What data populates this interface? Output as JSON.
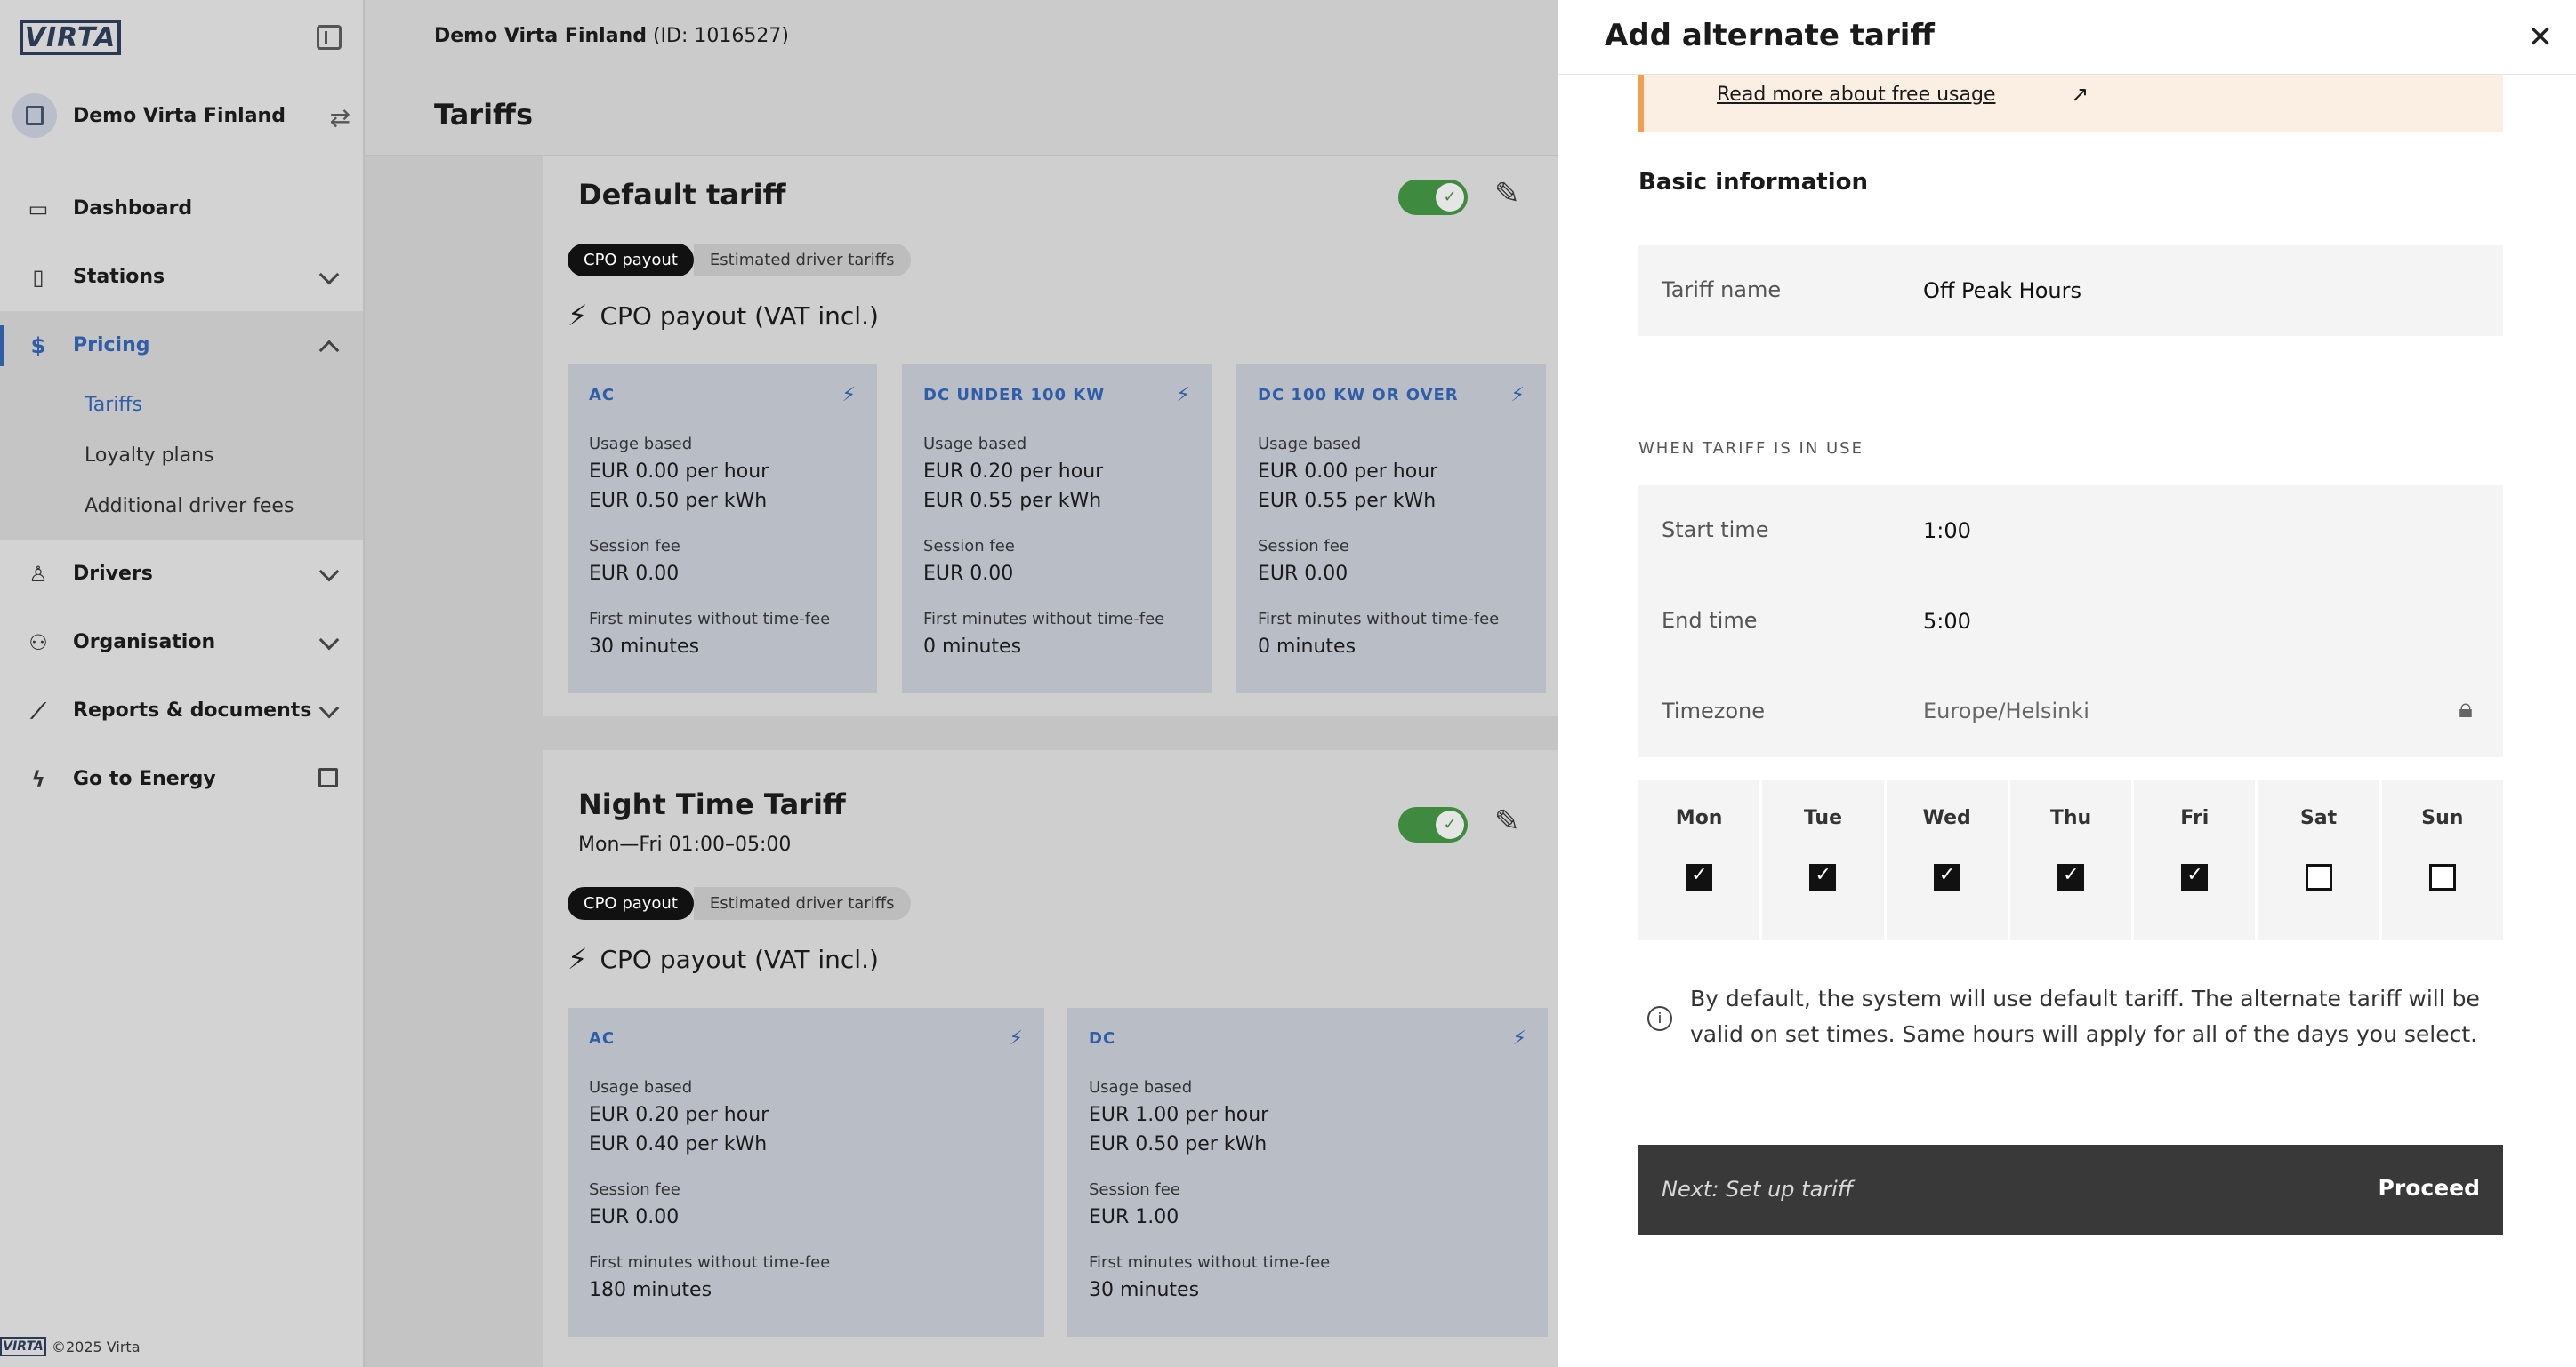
{
  "brand": {
    "logo_text": "VIRTA",
    "footer": "©2025 Virta"
  },
  "sidebar": {
    "org_name": "Demo Virta Finland",
    "items": [
      {
        "label": "Dashboard"
      },
      {
        "label": "Stations"
      },
      {
        "label": "Pricing"
      },
      {
        "label": "Drivers"
      },
      {
        "label": "Organisation"
      },
      {
        "label": "Reports & documents"
      },
      {
        "label": "Go to Energy"
      }
    ],
    "pricing_sub": [
      {
        "label": "Tariffs"
      },
      {
        "label": "Loyalty plans"
      },
      {
        "label": "Additional driver fees"
      }
    ]
  },
  "header": {
    "org_name": "Demo Virta Finland",
    "org_id": "(ID: 1016527)",
    "page_title": "Tariffs"
  },
  "tariffs": [
    {
      "name": "Default tariff",
      "schedule": "",
      "tabs": [
        "CPO payout",
        "Estimated driver tariffs"
      ],
      "payout_title": "CPO payout (VAT incl.)",
      "boxes": [
        {
          "type": "AC",
          "usage_label": "Usage based",
          "per_hour": "EUR 0.00 per hour",
          "per_kwh": "EUR 0.50 per kWh",
          "session_label": "Session fee",
          "session_fee": "EUR 0.00",
          "first_label": "First minutes without time-fee",
          "first_minutes": "30 minutes"
        },
        {
          "type": "DC UNDER 100 KW",
          "usage_label": "Usage based",
          "per_hour": "EUR 0.20 per hour",
          "per_kwh": "EUR 0.55 per kWh",
          "session_label": "Session fee",
          "session_fee": "EUR 0.00",
          "first_label": "First minutes without time-fee",
          "first_minutes": "0 minutes"
        },
        {
          "type": "DC 100 KW OR OVER",
          "usage_label": "Usage based",
          "per_hour": "EUR 0.00 per hour",
          "per_kwh": "EUR 0.55 per kWh",
          "session_label": "Session fee",
          "session_fee": "EUR 0.00",
          "first_label": "First minutes without time-fee",
          "first_minutes": "0 minutes"
        }
      ]
    },
    {
      "name": "Night Time Tariff",
      "schedule": "Mon—Fri 01:00–05:00",
      "tabs": [
        "CPO payout",
        "Estimated driver tariffs"
      ],
      "payout_title": "CPO payout (VAT incl.)",
      "boxes": [
        {
          "type": "AC",
          "usage_label": "Usage based",
          "per_hour": "EUR 0.20 per hour",
          "per_kwh": "EUR 0.40 per kWh",
          "session_label": "Session fee",
          "session_fee": "EUR 0.00",
          "first_label": "First minutes without time-fee",
          "first_minutes": "180 minutes"
        },
        {
          "type": "DC",
          "usage_label": "Usage based",
          "per_hour": "EUR 1.00 per hour",
          "per_kwh": "EUR 0.50 per kWh",
          "session_label": "Session fee",
          "session_fee": "EUR 1.00",
          "first_label": "First minutes without time-fee",
          "first_minutes": "30 minutes"
        }
      ]
    }
  ],
  "panel": {
    "title": "Add alternate tariff",
    "notice_link": "Read more about free usage",
    "section_title": "Basic information",
    "tariff_name_label": "Tariff name",
    "tariff_name_value": "Off Peak Hours",
    "when_caption": "WHEN TARIFF IS IN USE",
    "start_label": "Start time",
    "start_value": "1:00",
    "end_label": "End time",
    "end_value": "5:00",
    "timezone_label": "Timezone",
    "timezone_value": "Europe/Helsinki",
    "days": [
      {
        "label": "Mon",
        "checked": true
      },
      {
        "label": "Tue",
        "checked": true
      },
      {
        "label": "Wed",
        "checked": true
      },
      {
        "label": "Thu",
        "checked": true
      },
      {
        "label": "Fri",
        "checked": true
      },
      {
        "label": "Sat",
        "checked": false
      },
      {
        "label": "Sun",
        "checked": false
      }
    ],
    "info_text": "By default, the system will use default tariff. The alternate tariff will be valid on set times. Same hours will apply for all of the days you select.",
    "next_text": "Next: Set up tariff",
    "proceed_label": "Proceed"
  },
  "colors": {
    "accent": "#2f5da8",
    "toggle_on": "#3e8a3e",
    "notice_bg": "#fbeee2",
    "notice_border": "#f0a050",
    "proceed_bg": "#393939"
  }
}
